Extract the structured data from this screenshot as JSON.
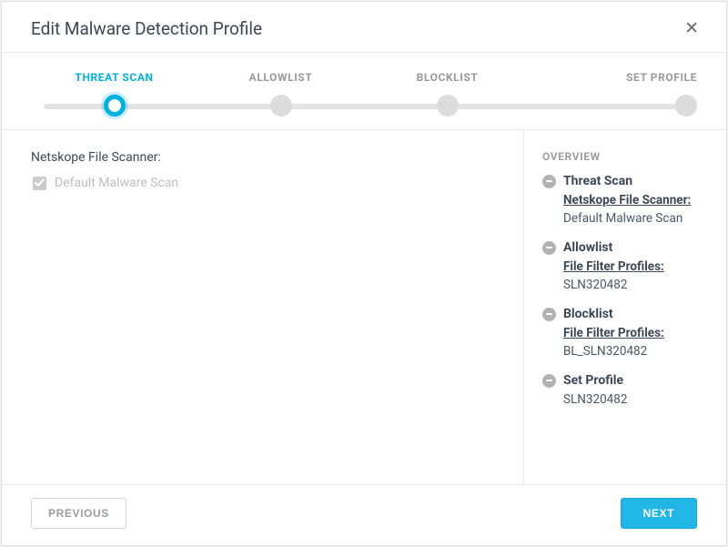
{
  "header": {
    "title": "Edit Malware Detection Profile"
  },
  "stepper": {
    "steps": [
      {
        "label": "THREAT SCAN",
        "active": true
      },
      {
        "label": "ALLOWLIST",
        "active": false
      },
      {
        "label": "BLOCKLIST",
        "active": false
      },
      {
        "label": "SET PROFILE",
        "active": false
      }
    ]
  },
  "main": {
    "section_heading": "Netskope File Scanner:",
    "checkbox_label": "Default Malware Scan"
  },
  "overview": {
    "title": "OVERVIEW",
    "groups": [
      {
        "title": "Threat Scan",
        "sub_label": "Netskope File Scanner:",
        "sub_value": "Default Malware Scan"
      },
      {
        "title": "Allowlist",
        "sub_label": "File Filter Profiles:",
        "sub_value": "SLN320482"
      },
      {
        "title": "Blocklist",
        "sub_label": "File Filter Profiles:",
        "sub_value": "BL_SLN320482"
      },
      {
        "title": "Set Profile",
        "sub_label": "",
        "sub_value": "SLN320482"
      }
    ]
  },
  "footer": {
    "previous": "PREVIOUS",
    "next": "NEXT"
  }
}
